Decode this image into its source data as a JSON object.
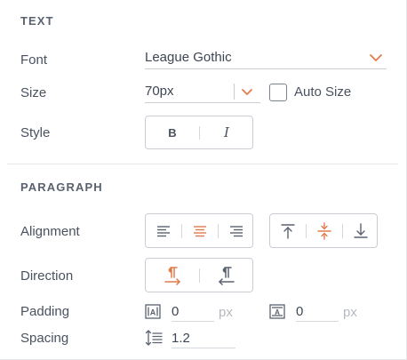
{
  "text_section": {
    "title": "TEXT",
    "font_label": "Font",
    "font_value": "League Gothic",
    "size_label": "Size",
    "size_value": "70px",
    "auto_size_label": "Auto Size",
    "auto_size_checked": false,
    "style_label": "Style",
    "bold_glyph": "B",
    "italic_glyph": "I"
  },
  "paragraph_section": {
    "title": "PARAGRAPH",
    "alignment_label": "Alignment",
    "alignment_active": "center",
    "vertical_alignment_active": "middle",
    "direction_label": "Direction",
    "direction_active": "ltr",
    "padding_label": "Padding",
    "padding_horizontal": "0",
    "padding_vertical": "0",
    "padding_unit": "px",
    "spacing_label": "Spacing",
    "spacing_value": "1.2"
  },
  "colors": {
    "accent": "#e07b4c",
    "icon": "#5a6270",
    "border": "#c9cdd3"
  }
}
